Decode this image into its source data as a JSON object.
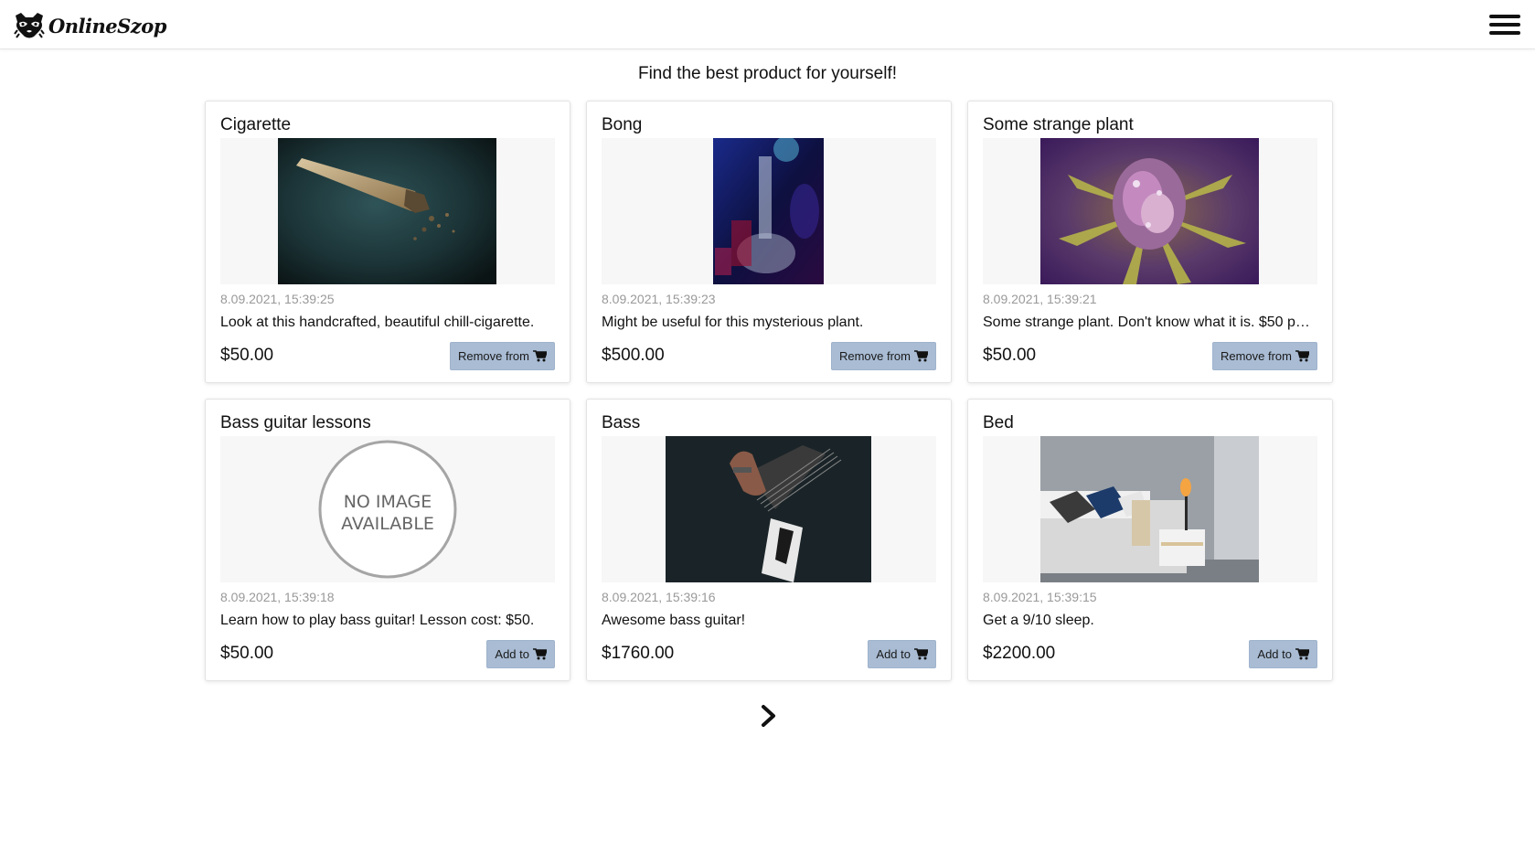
{
  "header": {
    "brand": "OnlineSzop",
    "logo_icon": "raccoon-logo-icon",
    "menu_icon": "hamburger-menu-icon"
  },
  "main": {
    "subtitle": "Find the best product for yourself!"
  },
  "products": [
    {
      "title": "Cigarette",
      "date": "8.09.2021, 15:39:25",
      "description": "Look at this handcrafted, beautiful chill-cigarette.",
      "price": "$50.00",
      "button_label": "Remove from",
      "button_icon": "shopping-cart-icon",
      "image": "photo"
    },
    {
      "title": "Bong",
      "date": "8.09.2021, 15:39:23",
      "description": "Might be useful for this mysterious plant.",
      "price": "$500.00",
      "button_label": "Remove from",
      "button_icon": "shopping-cart-icon",
      "image": "photo"
    },
    {
      "title": "Some strange plant",
      "date": "8.09.2021, 15:39:21",
      "description": "Some strange plant. Don't know what it is. $50 p…",
      "price": "$50.00",
      "button_label": "Remove from",
      "button_icon": "shopping-cart-icon",
      "image": "photo"
    },
    {
      "title": "Bass guitar lessons",
      "date": "8.09.2021, 15:39:18",
      "description": "Learn how to play bass guitar! Lesson cost: $50.",
      "price": "$50.00",
      "button_label": "Add to",
      "button_icon": "shopping-cart-icon",
      "image": "placeholder",
      "placeholder_line1": "NO IMAGE",
      "placeholder_line2": "AVAILABLE"
    },
    {
      "title": "Bass",
      "date": "8.09.2021, 15:39:16",
      "description": "Awesome bass guitar!",
      "price": "$1760.00",
      "button_label": "Add to",
      "button_icon": "shopping-cart-icon",
      "image": "photo"
    },
    {
      "title": "Bed",
      "date": "8.09.2021, 15:39:15",
      "description": "Get a 9/10 sleep.",
      "price": "$2200.00",
      "button_label": "Add to",
      "button_icon": "shopping-cart-icon",
      "image": "photo"
    }
  ],
  "pagination": {
    "next_icon": "chevron-right-icon"
  },
  "colors": {
    "button_bg": "#a9bcd4",
    "date_text": "#999999",
    "media_bg": "#f7f7f7"
  }
}
